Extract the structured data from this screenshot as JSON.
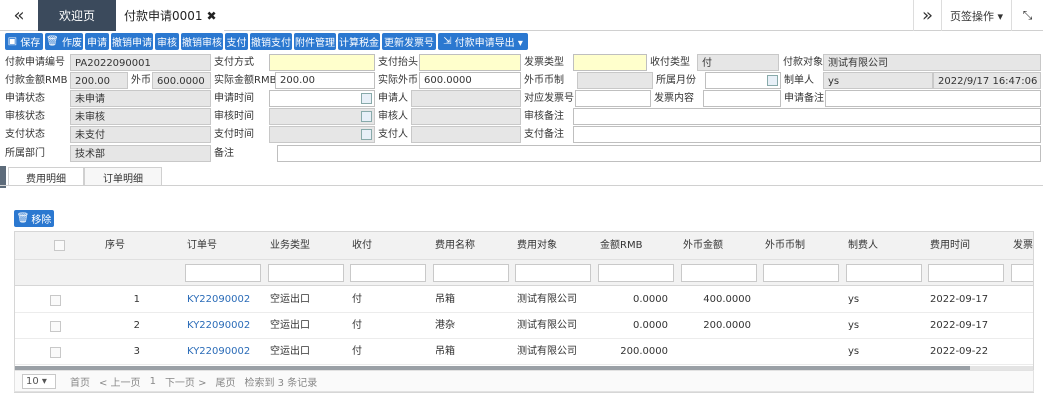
{
  "topbar": {
    "nav_left": "«",
    "tab_home": "欢迎页",
    "tab_active": "付款申请0001",
    "tab_close": "✖",
    "nav_right": "»",
    "page_ops": "页签操作 ▾",
    "expand": "⤡"
  },
  "toolbar": {
    "save": "保存",
    "void": "作废",
    "apply": "申请",
    "cancel_apply": "撤销申请",
    "review": "审核",
    "cancel_review": "撤销审核",
    "pay": "支付",
    "cancel_pay": "撤销支付",
    "attachments": "附件管理",
    "calc_tax": "计算税金",
    "update_invoice": "更新发票号",
    "export": "付款申请导出 ▾"
  },
  "form": {
    "apply_no_label": "付款申请编号",
    "apply_no": "PA2022090001",
    "pay_method_label": "支付方式",
    "pay_method": "",
    "pay_header_label": "支付抬头",
    "pay_header": "",
    "invoice_type_label": "发票类型",
    "invoice_type": "",
    "recv_type_label": "收付类型",
    "recv_type": "付",
    "pay_target_label": "付款对象",
    "pay_target": "测试有限公司",
    "amount_rmb_label": "付款金额RMB",
    "amount_rmb": "200.00",
    "foreign_label": "外币",
    "foreign": "600.0000",
    "actual_rmb_label": "实际金额RMB",
    "actual_rmb": "200.00",
    "actual_foreign_label": "实际外币",
    "actual_foreign": "600.0000",
    "foreign_currency_label": "外币币制",
    "foreign_currency": "",
    "month_label": "所属月份",
    "month": "",
    "creator_label": "制单人",
    "creator": "ys",
    "created_time": "2022/9/17 16:47:06",
    "apply_status_label": "申请状态",
    "apply_status": "未申请",
    "apply_time_label": "申请时间",
    "apply_time": "",
    "applicant_label": "申请人",
    "applicant": "",
    "invoice_no_label": "对应发票号",
    "invoice_no": "",
    "invoice_content_label": "发票内容",
    "invoice_content": "",
    "apply_remark_label": "申请备注",
    "apply_remark": "",
    "review_status_label": "审核状态",
    "review_status": "未审核",
    "review_time_label": "审核时间",
    "review_time": "",
    "reviewer_label": "审核人",
    "reviewer": "",
    "review_remark_label": "审核备注",
    "review_remark": "",
    "pay_status_label": "支付状态",
    "pay_status": "未支付",
    "pay_time_label": "支付时间",
    "pay_time": "",
    "payer_label": "支付人",
    "payer": "",
    "pay_remark_label": "支付备注",
    "pay_remark": "",
    "dept_label": "所属部门",
    "dept": "技术部",
    "remark_label": "备注",
    "remark": ""
  },
  "detail_tabs": [
    "费用明细",
    "订单明细"
  ],
  "remove_button": "移除",
  "table": {
    "columns": [
      "序号",
      "订单号",
      "业务类型",
      "收付",
      "费用名称",
      "费用对象",
      "金额RMB",
      "外币金额",
      "外币币制",
      "制费人",
      "费用时间",
      "发票"
    ],
    "rows": [
      {
        "seq": "1",
        "order": "KY22090002",
        "biz": "空运出口",
        "rp": "付",
        "fee": "吊箱",
        "target": "测试有限公司",
        "rmb": "0.0000",
        "fx": "400.0000",
        "cur": "",
        "maker": "ys",
        "date": "2022-09-17"
      },
      {
        "seq": "2",
        "order": "KY22090002",
        "biz": "空运出口",
        "rp": "付",
        "fee": "港杂",
        "target": "测试有限公司",
        "rmb": "0.0000",
        "fx": "200.0000",
        "cur": "",
        "maker": "ys",
        "date": "2022-09-17"
      },
      {
        "seq": "3",
        "order": "KY22090002",
        "biz": "空运出口",
        "rp": "付",
        "fee": "吊箱",
        "target": "测试有限公司",
        "rmb": "200.0000",
        "fx": "",
        "cur": "",
        "maker": "ys",
        "date": "2022-09-22"
      }
    ]
  },
  "pager": {
    "page_size": "10",
    "first": "首页",
    "prev": "< 上一页",
    "page": "1",
    "next": "下一页 >",
    "last": "尾页",
    "summary": "检索到 3 条记录"
  },
  "colors": {
    "toolbar_blue": "#2b78d0",
    "tab_dark": "#3b4a5c",
    "readonly_gray": "#e6e6e6",
    "required_yellow": "#ffffcc",
    "link_blue": "#2b6cb8"
  }
}
